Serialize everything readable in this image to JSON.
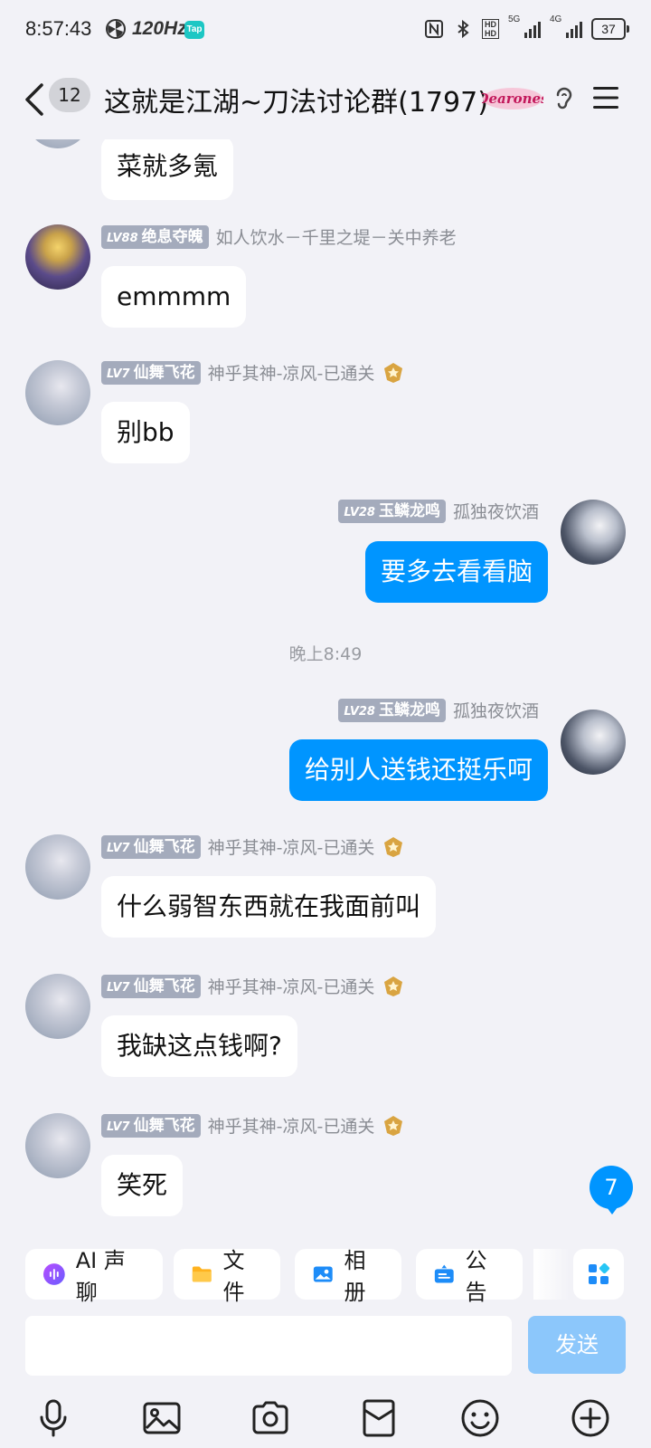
{
  "status_bar": {
    "time": "8:57:43",
    "refresh_rate": "120Hz",
    "tap_badge": "Tap",
    "network_5g": "5G",
    "network_4g": "4G",
    "battery": "37"
  },
  "header": {
    "unread_count": "12",
    "title": "这就是江湖~刀法讨论群(1797)",
    "badge_icon": "dearones-badge-icon"
  },
  "messages": [
    {
      "side": "left",
      "text": "菜就多氪"
    },
    {
      "side": "left",
      "level_prefix": "LV88",
      "name": "绝息夺魄",
      "title": "如人饮水－千里之堤－关中养老",
      "text": "emmmm"
    },
    {
      "side": "left",
      "level_prefix": "LV7",
      "name": "仙舞飞花",
      "title": "神乎其神-凉风-已通关",
      "text": "别bb"
    },
    {
      "side": "right",
      "level_prefix": "LV28",
      "name": "玉鳞龙鸣",
      "title": "孤独夜饮酒",
      "text": "要多去看看脑"
    },
    {
      "type": "time",
      "text": "晚上8:49"
    },
    {
      "side": "right",
      "level_prefix": "LV28",
      "name": "玉鳞龙鸣",
      "title": "孤独夜饮酒",
      "text": "给别人送钱还挺乐呵"
    },
    {
      "side": "left",
      "level_prefix": "LV7",
      "name": "仙舞飞花",
      "title": "神乎其神-凉风-已通关",
      "text": "什么弱智东西就在我面前叫"
    },
    {
      "side": "left",
      "level_prefix": "LV7",
      "name": "仙舞飞花",
      "title": "神乎其神-凉风-已通关",
      "text": "我缺这点钱啊?"
    },
    {
      "side": "left",
      "level_prefix": "LV7",
      "name": "仙舞飞花",
      "title": "神乎其神-凉风-已通关",
      "text": "笑死"
    }
  ],
  "new_message_count": "7",
  "toolbar": {
    "chips": [
      {
        "label": "AI 声聊",
        "icon": "ai-voice-icon"
      },
      {
        "label": "文件",
        "icon": "folder-icon"
      },
      {
        "label": "相册",
        "icon": "album-icon"
      },
      {
        "label": "公告",
        "icon": "announcement-icon"
      }
    ],
    "input_placeholder": "",
    "send_label": "发送",
    "bottom_icons": [
      "microphone-icon",
      "image-icon",
      "camera-icon",
      "red-packet-icon",
      "emoji-icon",
      "plus-icon"
    ]
  },
  "colors": {
    "accent": "#0095ff",
    "background": "#f2f2f7",
    "send_disabled": "#8cc7fb",
    "level_badge": "#a4abbc"
  }
}
